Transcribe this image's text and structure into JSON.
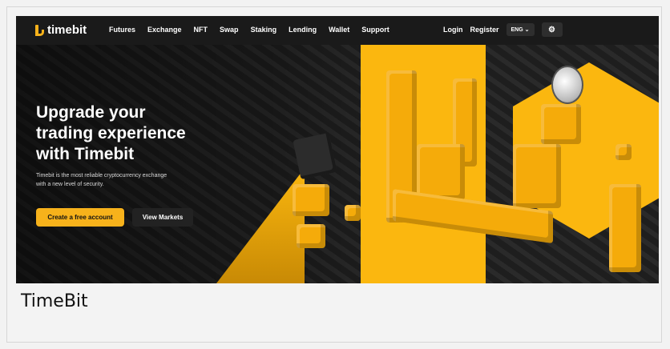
{
  "caption": "TimeBit",
  "brand": {
    "name": "timebit",
    "accent": "#f7b21b"
  },
  "nav": {
    "items": [
      "Futures",
      "Exchange",
      "NFT",
      "Swap",
      "Staking",
      "Lending",
      "Wallet",
      "Support"
    ],
    "login": "Login",
    "register": "Register",
    "language": "ENG ⌄",
    "settings_icon": "gear-icon"
  },
  "hero": {
    "headline_line1": "Upgrade your",
    "headline_line2": "trading experience",
    "headline_line3": "with Timebit",
    "subtitle_line1": "Timebit is the most reliable cryptocurrency exchange",
    "subtitle_line2": "with a new level of security.",
    "cta_primary": "Create a free account",
    "cta_secondary": "View Markets"
  }
}
